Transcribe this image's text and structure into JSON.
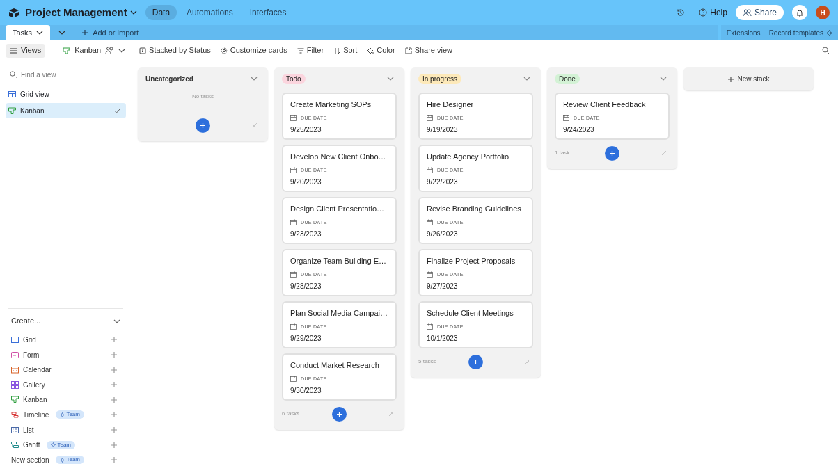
{
  "header": {
    "title": "Project Management",
    "nav": [
      {
        "label": "Data",
        "selected": true
      },
      {
        "label": "Automations",
        "selected": false
      },
      {
        "label": "Interfaces",
        "selected": false
      }
    ],
    "help": "Help",
    "share": "Share",
    "avatar": "H"
  },
  "tabbar": {
    "tabs": [
      {
        "label": "Tasks",
        "selected": true
      }
    ],
    "add": "Add or import",
    "right": [
      "Extensions",
      "Record templates"
    ]
  },
  "toolbar": {
    "views": "Views",
    "view_name": "Kanban",
    "actions": [
      {
        "kind": "stack",
        "label": "Stacked by Status"
      },
      {
        "kind": "customize",
        "label": "Customize cards"
      },
      {
        "kind": "filter",
        "label": "Filter"
      },
      {
        "kind": "sort",
        "label": "Sort"
      },
      {
        "kind": "color",
        "label": "Color"
      },
      {
        "kind": "share",
        "label": "Share view"
      }
    ]
  },
  "sidebar": {
    "search": {
      "placeholder": "Find a view"
    },
    "items": [
      {
        "kind": "grid",
        "label": "Grid view",
        "selected": false
      },
      {
        "kind": "kanban",
        "label": "Kanban",
        "selected": true
      }
    ],
    "create_title": "Create...",
    "create": [
      {
        "kind": "grid",
        "label": "Grid"
      },
      {
        "kind": "form",
        "label": "Form"
      },
      {
        "kind": "calendar",
        "label": "Calendar"
      },
      {
        "kind": "gallery",
        "label": "Gallery"
      },
      {
        "kind": "kanban",
        "label": "Kanban"
      },
      {
        "kind": "timeline",
        "label": "Timeline",
        "badge": "Team"
      },
      {
        "kind": "list",
        "label": "List"
      },
      {
        "kind": "gantt",
        "label": "Gantt",
        "badge": "Team"
      },
      {
        "kind": "section",
        "label": "New section",
        "badge": "Team"
      }
    ]
  },
  "stacks": [
    {
      "title": "Uncategorized",
      "empty_text": "No tasks"
    },
    {
      "title": "Todo",
      "color": "#fbd5de",
      "count": "6 tasks",
      "cards": [
        {
          "title": "Create Marketing SOPs",
          "field": "DUE DATE",
          "date": "9/25/2023"
        },
        {
          "title": "Develop New Client Onbo…",
          "field": "DUE DATE",
          "date": "9/20/2023"
        },
        {
          "title": "Design Client Presentatio…",
          "field": "DUE DATE",
          "date": "9/23/2023"
        },
        {
          "title": "Organize Team Building E…",
          "field": "DUE DATE",
          "date": "9/28/2023"
        },
        {
          "title": "Plan Social Media Campai…",
          "field": "DUE DATE",
          "date": "9/29/2023"
        },
        {
          "title": "Conduct Market Research",
          "field": "DUE DATE",
          "date": "9/30/2023"
        }
      ]
    },
    {
      "title": "In progress",
      "color": "#fde9b9",
      "count": "5 tasks",
      "cards": [
        {
          "title": "Hire Designer",
          "field": "DUE DATE",
          "date": "9/19/2023"
        },
        {
          "title": "Update Agency Portfolio",
          "field": "DUE DATE",
          "date": "9/22/2023"
        },
        {
          "title": "Revise Branding Guidelines",
          "field": "DUE DATE",
          "date": "9/26/2023"
        },
        {
          "title": "Finalize Project Proposals",
          "field": "DUE DATE",
          "date": "9/27/2023"
        },
        {
          "title": "Schedule Client Meetings",
          "field": "DUE DATE",
          "date": "10/1/2023"
        }
      ]
    },
    {
      "title": "Done",
      "color": "#d3f2d5",
      "count": "1 task",
      "cards": [
        {
          "title": "Review Client Feedback",
          "field": "DUE DATE",
          "date": "9/24/2023"
        }
      ]
    }
  ],
  "new_stack": "New stack"
}
